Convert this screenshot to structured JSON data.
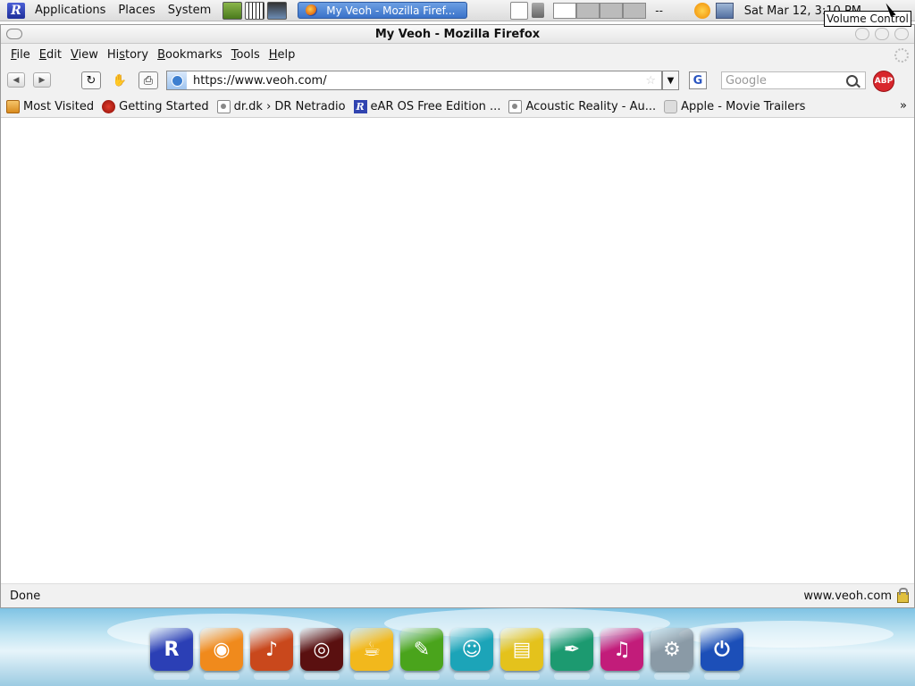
{
  "panel": {
    "menus": [
      "Applications",
      "Places",
      "System"
    ],
    "task_button": "My Veoh - Mozilla Firef...",
    "workspace_indicator": "--",
    "clock": "Sat Mar 12,  3:10 PM",
    "tooltip": "Volume Control"
  },
  "window": {
    "title": "My Veoh - Mozilla Firefox"
  },
  "menubar": [
    {
      "label": "File",
      "accel": "F",
      "rest": "ile"
    },
    {
      "label": "Edit",
      "accel": "E",
      "rest": "dit"
    },
    {
      "label": "View",
      "accel": "V",
      "rest": "iew"
    },
    {
      "label": "History",
      "pre": "Hi",
      "accel": "s",
      "rest": "tory"
    },
    {
      "label": "Bookmarks",
      "accel": "B",
      "rest": "ookmarks"
    },
    {
      "label": "Tools",
      "accel": "T",
      "rest": "ools"
    },
    {
      "label": "Help",
      "accel": "H",
      "rest": "elp"
    }
  ],
  "navbar": {
    "url": "https://www.veoh.com/",
    "search_engine_letter": "G",
    "search_placeholder": "Google",
    "adblock_label": "ABP"
  },
  "bookmarks": [
    {
      "label": "Most Visited",
      "icon": "folder-icon"
    },
    {
      "label": "Getting Started",
      "icon": "bug-icon"
    },
    {
      "label": "dr.dk › DR Netradio",
      "icon": "page-icon"
    },
    {
      "label": "eAR OS Free Edition ...",
      "icon": "r-logo-icon"
    },
    {
      "label": "Acoustic Reality - Au...",
      "icon": "page-icon"
    },
    {
      "label": "Apple - Movie Trailers",
      "icon": "apple-icon"
    }
  ],
  "bookmarks_overflow": "»",
  "status": {
    "left": "Done",
    "right": "www.veoh.com"
  },
  "dock": [
    {
      "name": "ear-os-icon",
      "color": "#2b3fb5",
      "glyph": "R"
    },
    {
      "name": "browser-icon",
      "color": "#f08a1c",
      "glyph": "◉"
    },
    {
      "name": "guitar-icon",
      "color": "#c9481c",
      "glyph": "♪"
    },
    {
      "name": "media-icon",
      "color": "#5a1010",
      "glyph": "◎"
    },
    {
      "name": "java-icon",
      "color": "#f2b81c",
      "glyph": "☕"
    },
    {
      "name": "photo-editor-icon",
      "color": "#4aa41c",
      "glyph": "✎"
    },
    {
      "name": "messenger-icon",
      "color": "#1ca4b8",
      "glyph": "☺"
    },
    {
      "name": "files-icon",
      "color": "#e4c21c",
      "glyph": "▤"
    },
    {
      "name": "writer-icon",
      "color": "#1c9a70",
      "glyph": "✒"
    },
    {
      "name": "music-icon",
      "color": "#c21c7a",
      "glyph": "♫"
    },
    {
      "name": "settings-icon",
      "color": "#8a9aa6",
      "glyph": "⚙"
    },
    {
      "name": "power-icon",
      "color": "#1c4fb8",
      "glyph": "⏻"
    }
  ]
}
